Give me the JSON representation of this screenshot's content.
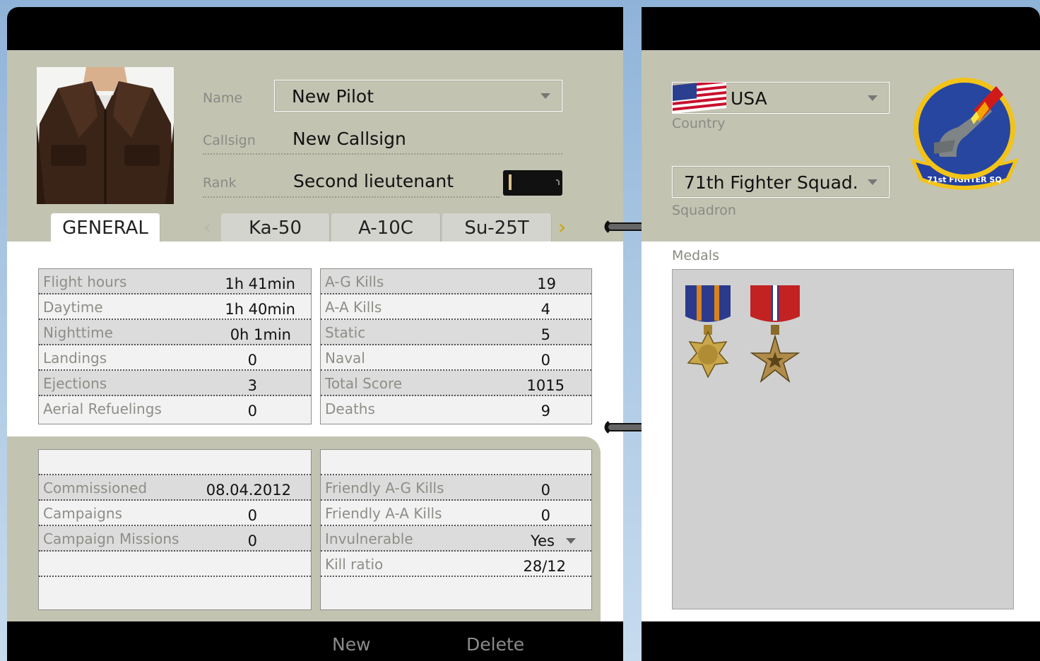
{
  "pilot": {
    "name_label": "Name",
    "name_value": "New Pilot",
    "callsign_label": "Callsign",
    "callsign_value": "New Callsign",
    "rank_label": "Rank",
    "rank_value": "Second lieutenant"
  },
  "tabs": [
    {
      "label": "GENERAL",
      "active": true
    },
    {
      "label": "Ka-50",
      "active": false
    },
    {
      "label": "A-10C",
      "active": false
    },
    {
      "label": "Su-25T",
      "active": false
    }
  ],
  "stats_left": [
    {
      "label": "Flight hours",
      "value": "1h 41min"
    },
    {
      "label": "Daytime",
      "value": "1h 40min"
    },
    {
      "label": "Nighttime",
      "value": "0h 1min"
    },
    {
      "label": "Landings",
      "value": "0"
    },
    {
      "label": "Ejections",
      "value": "3"
    },
    {
      "label": "Aerial Refuelings",
      "value": "0"
    }
  ],
  "stats_right": [
    {
      "label": "A-G Kills",
      "value": "19"
    },
    {
      "label": "A-A Kills",
      "value": "4"
    },
    {
      "label": "Static",
      "value": "5"
    },
    {
      "label": "Naval",
      "value": "0"
    },
    {
      "label": "Total Score",
      "value": "1015"
    },
    {
      "label": "Deaths",
      "value": "9"
    }
  ],
  "career_left": [
    {
      "label": "",
      "value": ""
    },
    {
      "label": "Commissioned",
      "value": "08.04.2012"
    },
    {
      "label": "Campaigns",
      "value": "0"
    },
    {
      "label": "Campaign Missions",
      "value": "0"
    },
    {
      "label": "",
      "value": ""
    }
  ],
  "career_right": [
    {
      "label": "",
      "value": ""
    },
    {
      "label": "Friendly A-G Kills",
      "value": "0"
    },
    {
      "label": "Friendly A-A Kills",
      "value": "0"
    },
    {
      "label": "Invulnerable",
      "value": "Yes"
    },
    {
      "label": "Kill ratio",
      "value": "28/12"
    }
  ],
  "buttons": {
    "new": "New",
    "delete": "Delete"
  },
  "country": {
    "label": "Country",
    "value": "USA",
    "flag_icon": "usa-flag-icon"
  },
  "squadron": {
    "label": "Squadron",
    "value": "71th Fighter Squad.",
    "emblem_text": "71st FIGHTER SQ"
  },
  "medals": {
    "label": "Medals",
    "items": [
      "air-medal-icon",
      "bronze-star-medal-icon"
    ]
  },
  "colors": {
    "khaki": "#c3c3b2",
    "bar": "#000000",
    "row_shade": "#dcdcdc",
    "label_gray": "#8e8e88"
  }
}
